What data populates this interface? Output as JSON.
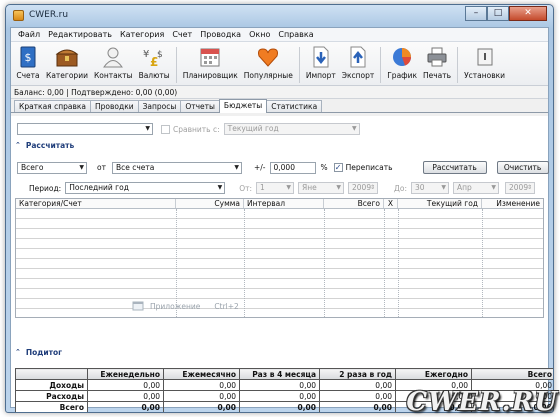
{
  "window": {
    "title": "CWER.ru",
    "minimize": "–",
    "maximize": "□",
    "close": "✕"
  },
  "menu": [
    "Файл",
    "Редактировать",
    "Категория",
    "Счет",
    "Проводка",
    "Окно",
    "Справка"
  ],
  "toolbar": {
    "accounts": "Счета",
    "categories": "Категории",
    "contacts": "Контакты",
    "currencies": "Валюты",
    "planner": "Планировщик",
    "popular": "Популярные",
    "import": "Импорт",
    "export": "Экспорт",
    "chart": "График",
    "print": "Печать",
    "settings": "Установки"
  },
  "status_line": "Баланс: 0,00 | Подтверждено: 0,00 (0,00)",
  "tabs": [
    "Краткая справка",
    "Проводки",
    "Запросы",
    "Отчеты",
    "Бюджеты",
    "Статистика"
  ],
  "active_tab": "Бюджеты",
  "budget": {
    "budget_select": "",
    "compare_label": "Сравнить с:",
    "compare_value": "Текущий год"
  },
  "calc": {
    "section_title": "Рассчитать",
    "scope_value": "Всего",
    "from_label": "от",
    "accounts_value": "Все счета",
    "plusminus_label": "+/-",
    "amount_value": "0,000",
    "percent_label": "%",
    "overwrite_label": "Переписать",
    "overwrite_check": "✓",
    "calc_button": "Рассчитать",
    "clear_button": "Очистить",
    "period_label": "Период:",
    "period_value": "Последний год",
    "from_date_label": "От:",
    "from_day": "1",
    "from_month": "Яне",
    "from_year": "2009",
    "to_label": "До:",
    "to_day": "30",
    "to_month": "Апр",
    "to_year": "2009"
  },
  "grid": {
    "columns": [
      "Категория/Счет",
      "Сумма",
      "Интервал",
      "Всего",
      "X",
      "Текущий год",
      "Изменение"
    ]
  },
  "summary": {
    "section_title": "Подитог",
    "columns": [
      "",
      "Еженедельно",
      "Ежемесячно",
      "Раз в 4 месяца",
      "2 раза в год",
      "Ежегодно",
      "Всего"
    ],
    "rows": [
      [
        "Доходы",
        "0,00",
        "0,00",
        "0,00",
        "0,00",
        "0,00",
        "0,00"
      ],
      [
        "Расходы",
        "0,00",
        "0,00",
        "0,00",
        "0,00",
        "0,00",
        "0,00"
      ],
      [
        "Всего",
        "0,00",
        "0,00",
        "0,00",
        "0,00",
        "0,00",
        "0,00"
      ]
    ]
  },
  "tooltip": {
    "label": "Приложение",
    "shortcut": "Ctrl+2"
  },
  "watermark": "CWER.RU",
  "colors": {
    "accent": "#1f3d7a",
    "title_bar": "#a9c6e3",
    "close": "#c44a2c"
  }
}
